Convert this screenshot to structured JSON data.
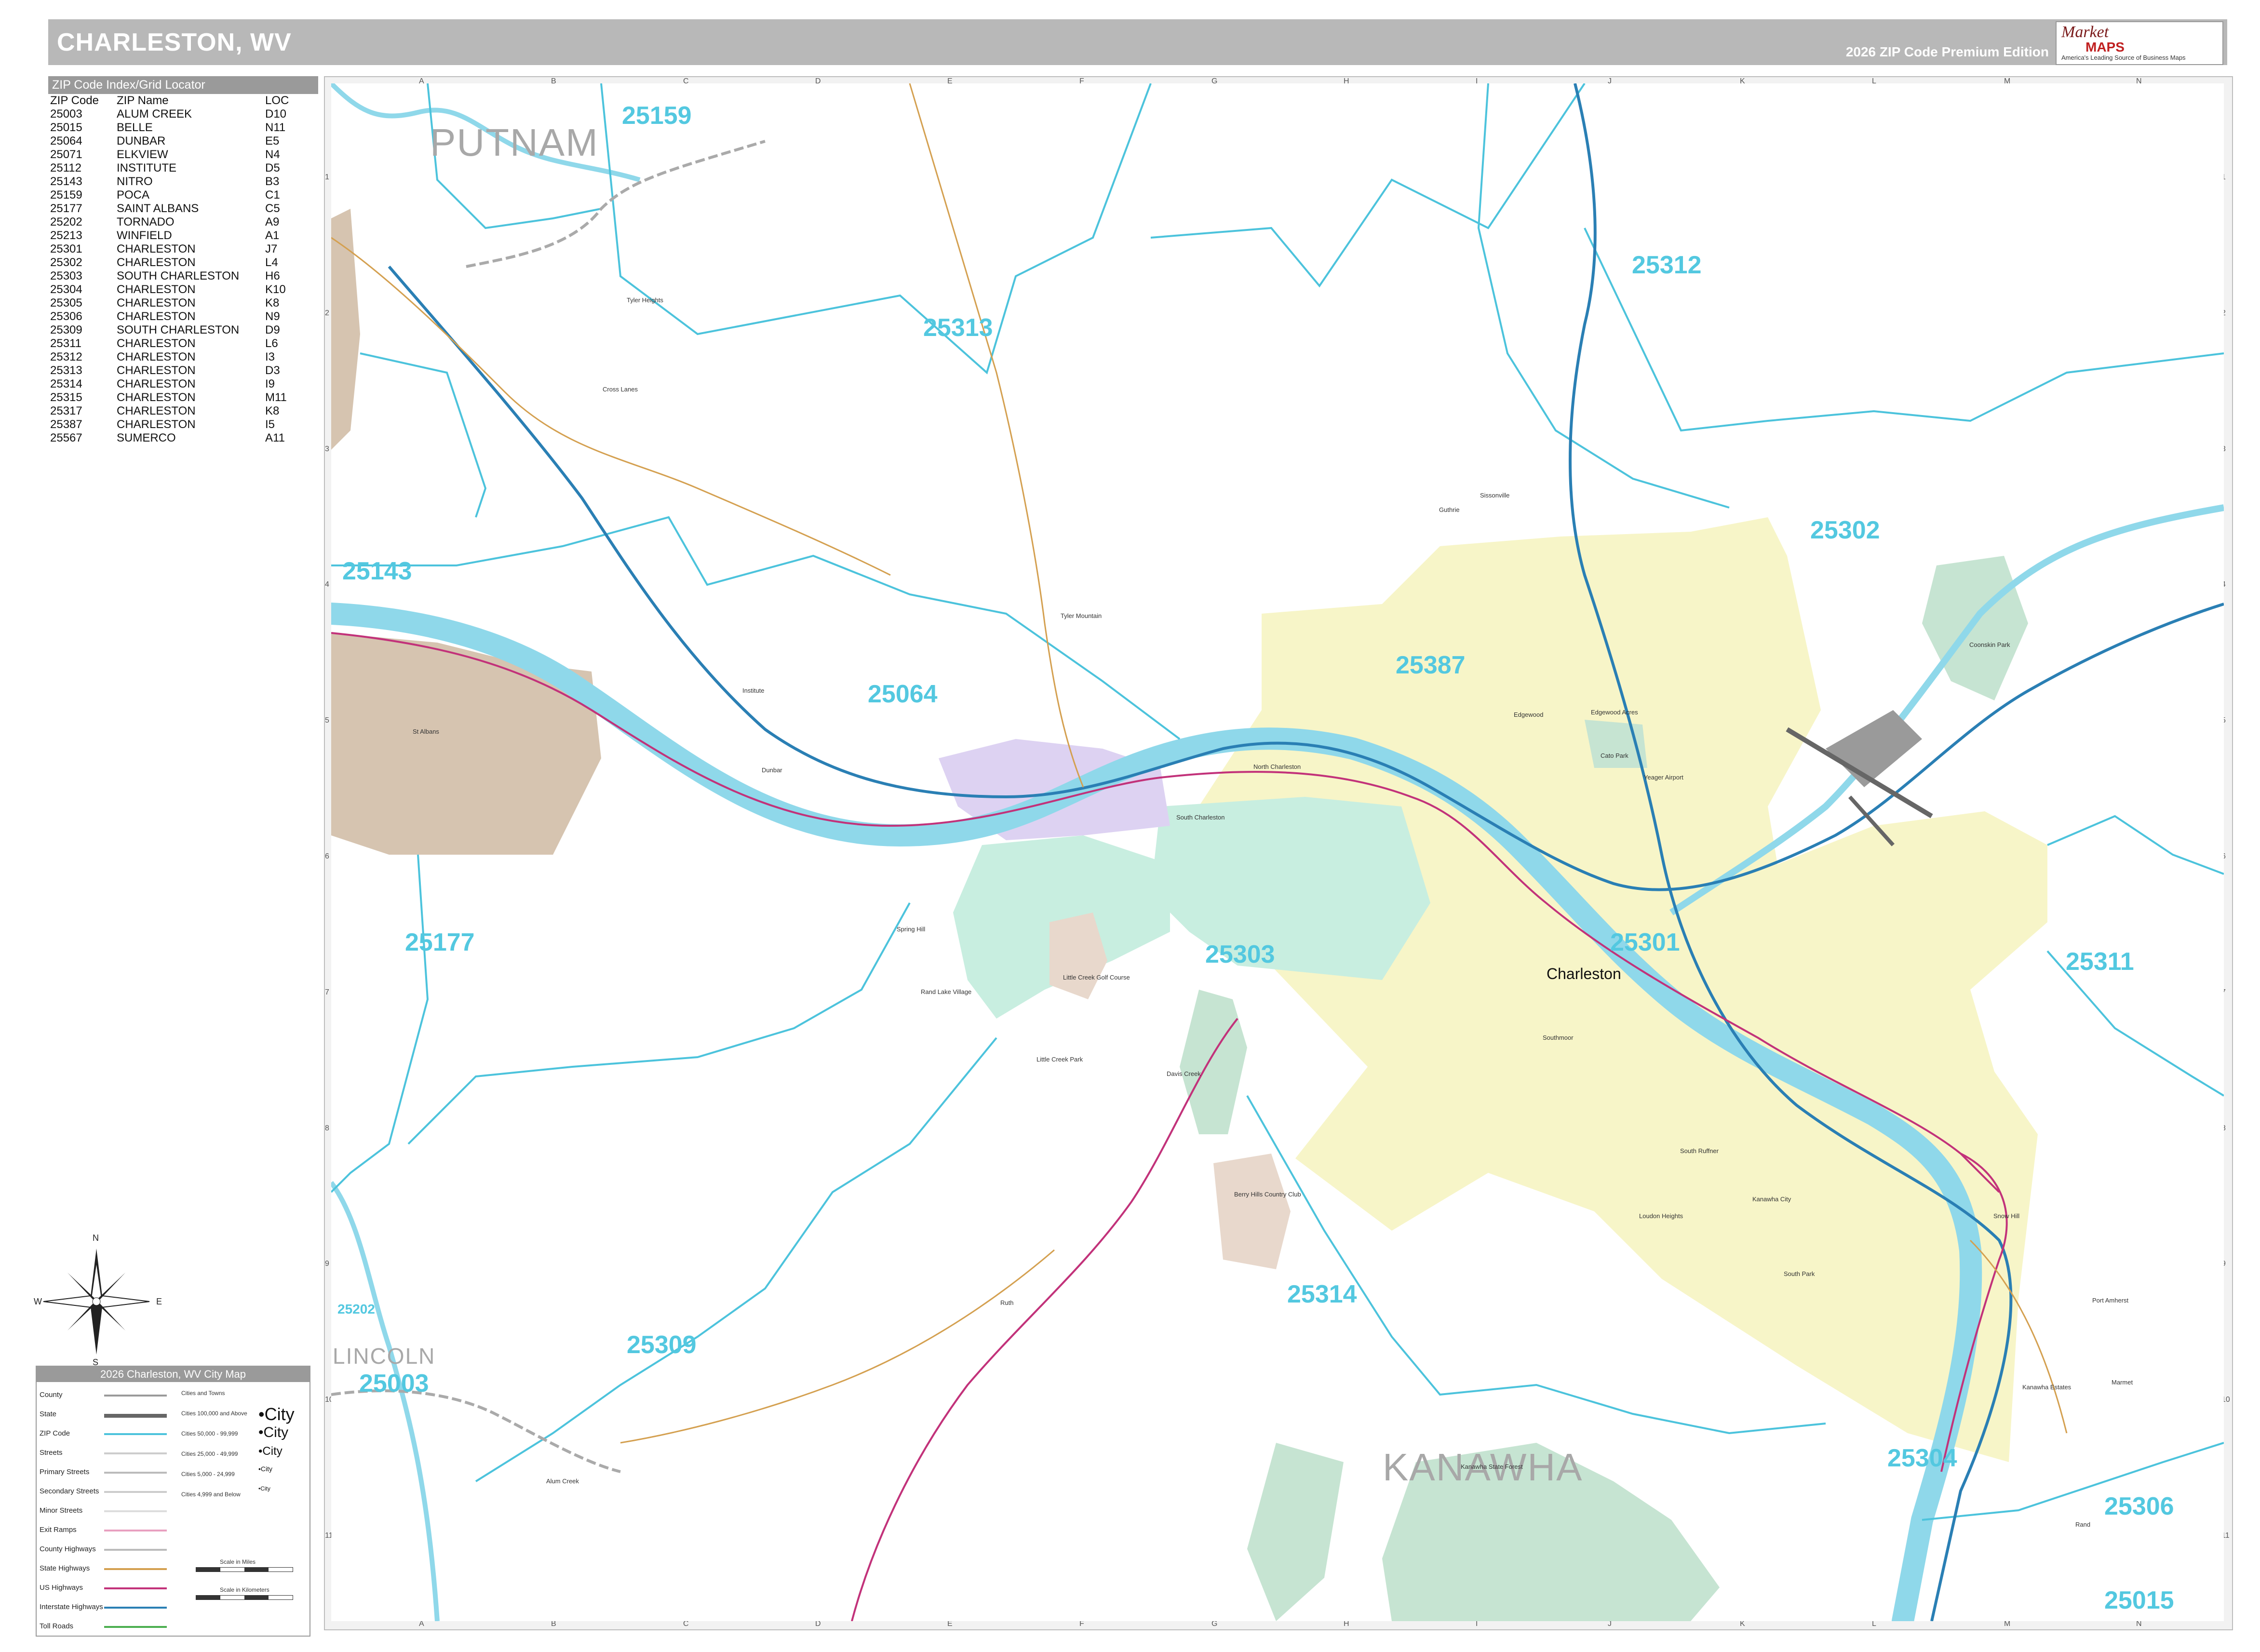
{
  "header": {
    "title": "CHARLESTON, WV",
    "edition": "2026 ZIP Code Premium Edition",
    "logo": {
      "brand_top": "Market",
      "brand_bottom": "MAPS",
      "tagline": "America's Leading Source of Business Maps"
    }
  },
  "zip_index": {
    "title": "ZIP Code Index/Grid Locator",
    "columns": [
      "ZIP Code",
      "ZIP Name",
      "LOC"
    ],
    "rows": [
      [
        "25003",
        "ALUM CREEK",
        "D10"
      ],
      [
        "25015",
        "BELLE",
        "N11"
      ],
      [
        "25064",
        "DUNBAR",
        "E5"
      ],
      [
        "25071",
        "ELKVIEW",
        "N4"
      ],
      [
        "25112",
        "INSTITUTE",
        "D5"
      ],
      [
        "25143",
        "NITRO",
        "B3"
      ],
      [
        "25159",
        "POCA",
        "C1"
      ],
      [
        "25177",
        "SAINT ALBANS",
        "C5"
      ],
      [
        "25202",
        "TORNADO",
        "A9"
      ],
      [
        "25213",
        "WINFIELD",
        "A1"
      ],
      [
        "25301",
        "CHARLESTON",
        "J7"
      ],
      [
        "25302",
        "CHARLESTON",
        "L4"
      ],
      [
        "25303",
        "SOUTH CHARLESTON",
        "H6"
      ],
      [
        "25304",
        "CHARLESTON",
        "K10"
      ],
      [
        "25305",
        "CHARLESTON",
        "K8"
      ],
      [
        "25306",
        "CHARLESTON",
        "N9"
      ],
      [
        "25309",
        "SOUTH CHARLESTON",
        "D9"
      ],
      [
        "25311",
        "CHARLESTON",
        "L6"
      ],
      [
        "25312",
        "CHARLESTON",
        "I3"
      ],
      [
        "25313",
        "CHARLESTON",
        "D3"
      ],
      [
        "25314",
        "CHARLESTON",
        "I9"
      ],
      [
        "25315",
        "CHARLESTON",
        "M11"
      ],
      [
        "25317",
        "CHARLESTON",
        "K8"
      ],
      [
        "25387",
        "CHARLESTON",
        "I5"
      ],
      [
        "25567",
        "SUMERCO",
        "A11"
      ]
    ]
  },
  "map": {
    "grid_columns": [
      "A",
      "B",
      "C",
      "D",
      "E",
      "F",
      "G",
      "H",
      "I",
      "J",
      "K",
      "L",
      "M",
      "N"
    ],
    "grid_rows": [
      "1",
      "2",
      "3",
      "4",
      "5",
      "6",
      "7",
      "8",
      "9",
      "10",
      "11"
    ],
    "zip_labels": [
      {
        "text": "25159"
      },
      {
        "text": "25313"
      },
      {
        "text": "25312"
      },
      {
        "text": "25143"
      },
      {
        "text": "25064"
      },
      {
        "text": "25387"
      },
      {
        "text": "25302"
      },
      {
        "text": "25177"
      },
      {
        "text": "25303"
      },
      {
        "text": "25301"
      },
      {
        "text": "25311"
      },
      {
        "text": "25314"
      },
      {
        "text": "25309"
      },
      {
        "text": "25003"
      },
      {
        "text": "25304"
      },
      {
        "text": "25306"
      },
      {
        "text": "25015"
      },
      {
        "text": "25202"
      }
    ],
    "county_labels": [
      "PUTNAM",
      "KANAWHA",
      "LINCOLN"
    ],
    "city_label": "Charleston",
    "places": [
      "Tyler Heights",
      "Cross Lanes",
      "Guthrie",
      "Tyler Mountain",
      "Institute",
      "Dunbar",
      "North Charleston",
      "South Charleston",
      "Edgewood",
      "Edgewood Acres",
      "Spring Hill",
      "Rand Lake Village",
      "Davis Creek",
      "Loudon Heights",
      "South Ruffner",
      "Kanawha City",
      "South Park",
      "Port Amherst",
      "Marmet",
      "Alum Creek",
      "Ruth",
      "Snow Hill",
      "St Albans",
      "Sissonville",
      "Kanawha Estates",
      "Rand",
      "Southmoor",
      "Coonskin Park",
      "Cato Park",
      "Little Creek Golf Course",
      "Little Creek Park",
      "Berry Hills Country Club",
      "Kanawha State Forest",
      "Yeager Airport"
    ],
    "parks": [
      "COONSKIN PARK",
      "CATO PARK",
      "LITTLE CREEK GOLF COURSE",
      "LITTLE CREEK PARK",
      "BERRY HILLS COUNTRY CLUB",
      "KANAWHA STATE FOREST"
    ],
    "colors": {
      "water": "#8fd8ea",
      "zip_boundary": "#4cc3dc",
      "interstate": "#2a7fb4",
      "us_highway": "#c2327a",
      "state_highway": "#d4a050",
      "zone_yellow": "#f7f5c8",
      "zone_green": "#c8eee0",
      "zone_purple": "#ddd2f2",
      "zone_tan": "#d6c4b0",
      "park_green": "#c6e4d2"
    }
  },
  "compass": {
    "n": "N",
    "s": "S",
    "e": "E",
    "w": "W"
  },
  "legend": {
    "title": "2026 Charleston, WV City Map",
    "items": [
      "County",
      "State",
      "ZIP Code",
      "Streets",
      "Primary Streets",
      "Secondary Streets",
      "Minor Streets",
      "Exit Ramps",
      "County Highways",
      "State Highways",
      "US Highways",
      "Interstate Highways",
      "Toll Roads"
    ],
    "city_sizes": [
      {
        "label": "Cities and Towns",
        "sample": ""
      },
      {
        "label": "Cities 100,000 and Above",
        "sample": "City"
      },
      {
        "label": "Cities 50,000 - 99,999",
        "sample": "City"
      },
      {
        "label": "Cities 25,000 - 49,999",
        "sample": "City"
      },
      {
        "label": "Cities 5,000 - 24,999",
        "sample": "City"
      },
      {
        "label": "Cities 4,999 and Below",
        "sample": "City"
      }
    ],
    "scale_miles": "Scale in Miles",
    "scale_km": "Scale in Kilometers"
  }
}
